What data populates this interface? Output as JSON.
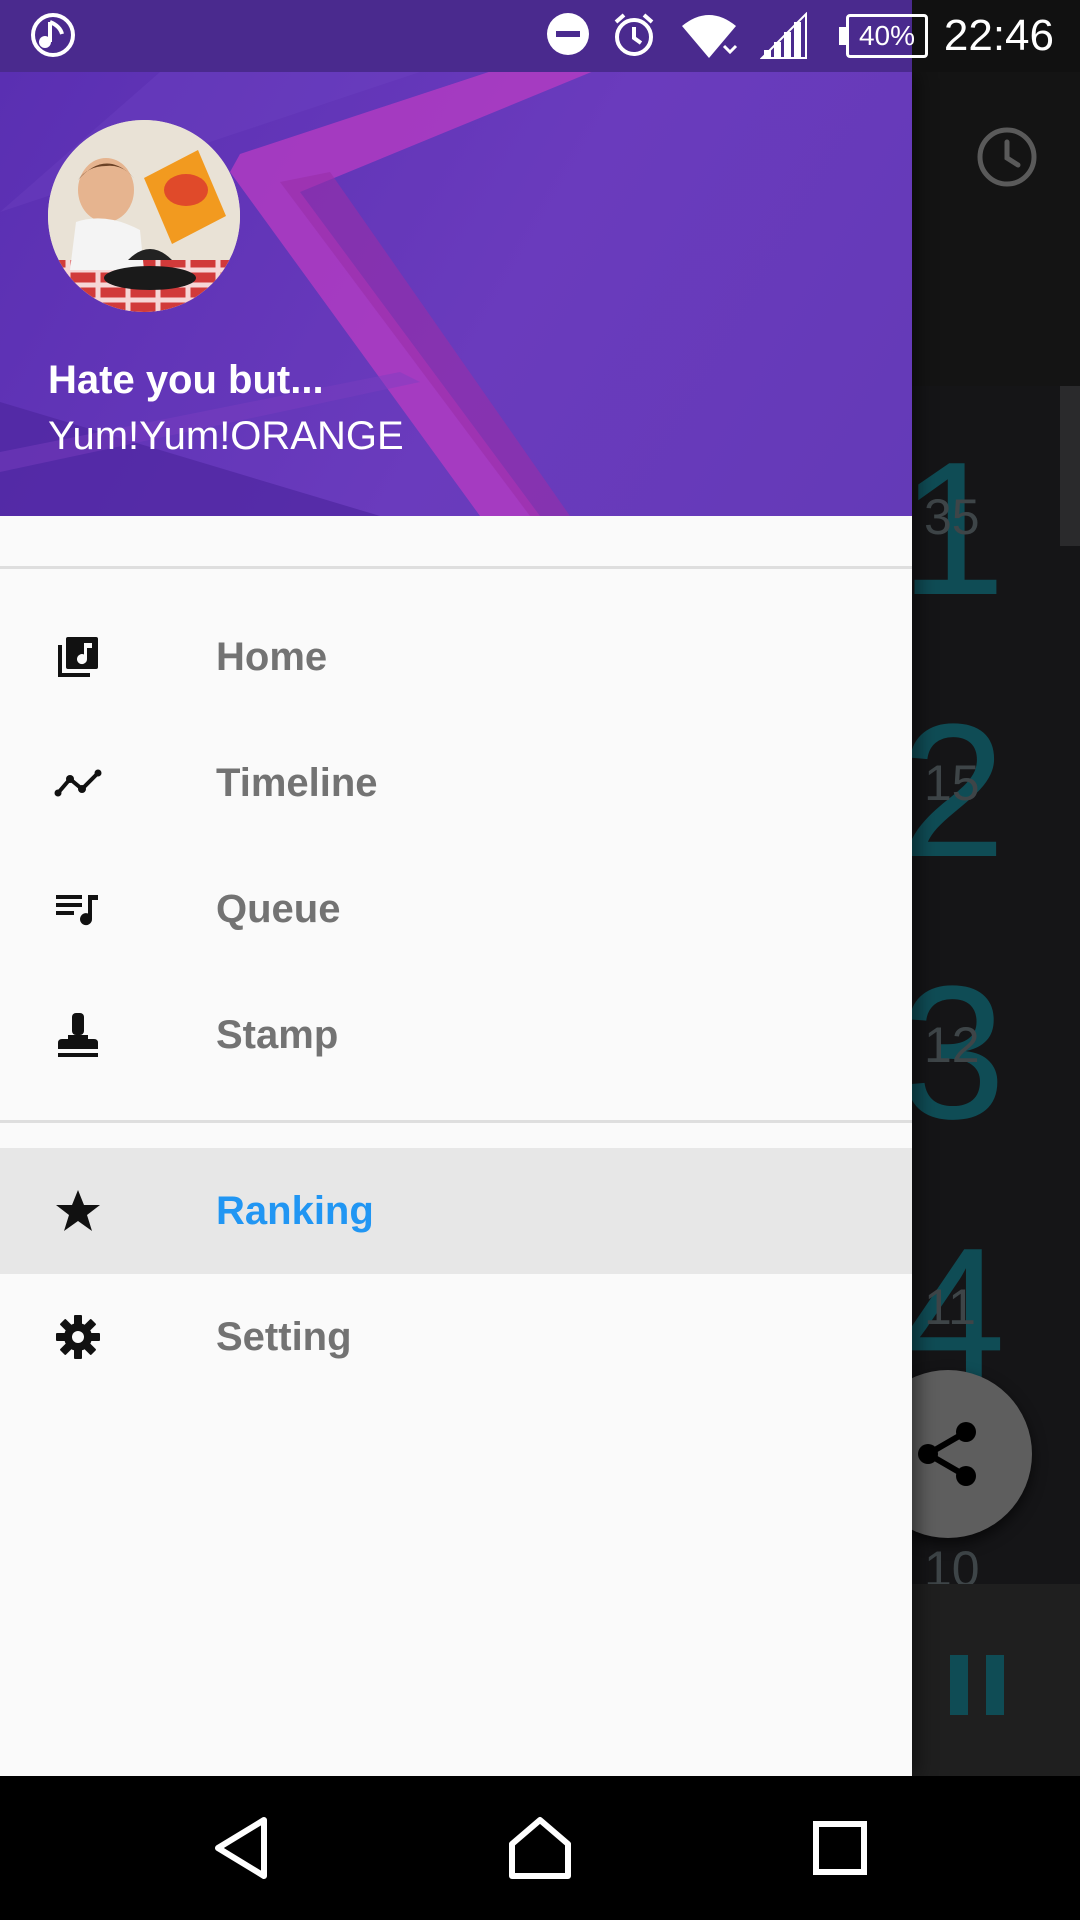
{
  "status_bar": {
    "time": "22:46",
    "battery": "40%",
    "icons": [
      "music-app-icon",
      "dnd-icon",
      "alarm-icon",
      "wifi-icon",
      "signal-icon",
      "battery-icon"
    ]
  },
  "drawer": {
    "header": {
      "title": "Hate you but...",
      "subtitle": "Yum!Yum!ORANGE",
      "avatar_icon": "album-art-avatar"
    },
    "items": [
      {
        "label": "Home",
        "icon": "music-library-icon",
        "active": false
      },
      {
        "label": "Timeline",
        "icon": "timeline-icon",
        "active": false
      },
      {
        "label": "Queue",
        "icon": "queue-music-icon",
        "active": false
      },
      {
        "label": "Stamp",
        "icon": "stamp-icon",
        "active": false
      },
      {
        "label": "Ranking",
        "icon": "star-icon",
        "active": true
      },
      {
        "label": "Setting",
        "icon": "gear-icon",
        "active": false
      }
    ],
    "colors": {
      "accent": "#2196f3",
      "header": "#643ab7",
      "label": "#737373"
    }
  },
  "background": {
    "ranks": [
      "1",
      "2",
      "3",
      "4"
    ],
    "counts": [
      "35",
      "15",
      "12",
      "11",
      "10"
    ]
  },
  "nav_bar": {
    "icons": [
      "back-icon",
      "home-icon",
      "recents-icon"
    ]
  }
}
